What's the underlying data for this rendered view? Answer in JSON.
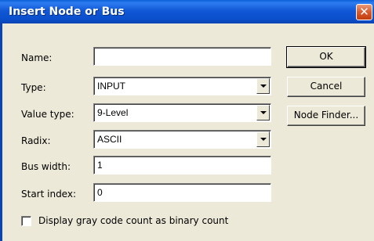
{
  "window": {
    "title": "Insert Node or Bus",
    "close_glyph": "✕"
  },
  "form": {
    "name": {
      "label": "Name:",
      "value": ""
    },
    "type": {
      "label": "Type:",
      "value": "INPUT"
    },
    "value_type": {
      "label": "Value type:",
      "value": "9-Level"
    },
    "radix": {
      "label": "Radix:",
      "value": "ASCII"
    },
    "bus_width": {
      "label": "Bus width:",
      "value": "1"
    },
    "start_index": {
      "label": "Start index:",
      "value": "0"
    }
  },
  "buttons": {
    "ok": "OK",
    "cancel": "Cancel",
    "node_finder": "Node Finder..."
  },
  "checkbox": {
    "label": "Display gray code count as binary count",
    "checked": false
  },
  "colors": {
    "titlebar": "#0a4fcb",
    "dialog_bg": "#ece9d8",
    "close_button": "#d75a2d"
  }
}
